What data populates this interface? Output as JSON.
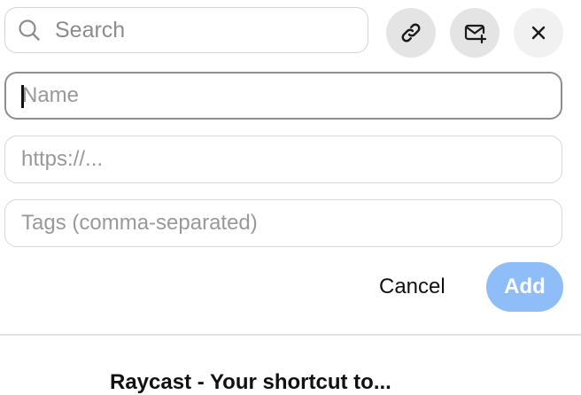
{
  "search": {
    "placeholder": "Search",
    "value": ""
  },
  "toolbar": {
    "link_icon": "link-icon",
    "mail_icon": "mail-plus-icon",
    "close_icon": "close-icon"
  },
  "form": {
    "name_placeholder": "Name",
    "url_placeholder": "https://...",
    "tags_placeholder": "Tags (comma-separated)",
    "cancel_label": "Cancel",
    "add_label": "Add"
  },
  "colors": {
    "add_button": "#8fbdf8",
    "focused_border": "#8e8e8e"
  },
  "results": {
    "first_title": "Raycast - Your shortcut to..."
  }
}
